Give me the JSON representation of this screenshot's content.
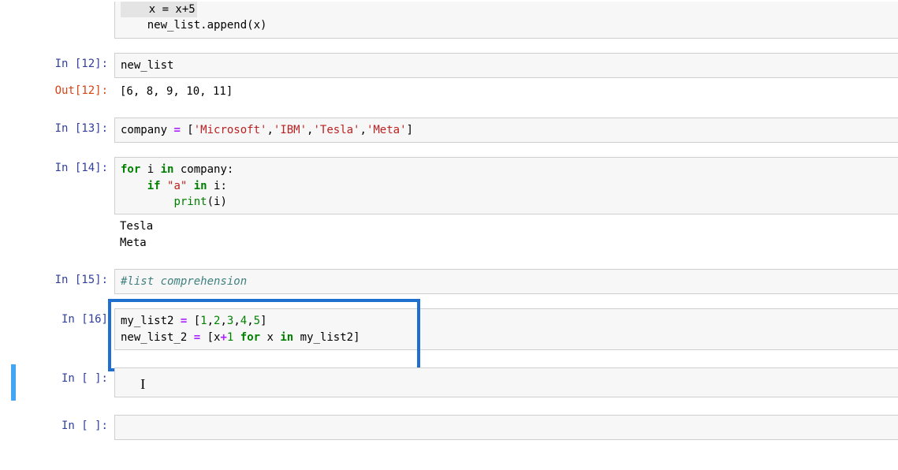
{
  "cells": {
    "partial_top": {
      "line1": "    x = x+5",
      "line2_a": "    new_list.append(x)"
    },
    "c12": {
      "prompt_in": "In [12]:",
      "prompt_out": "Out[12]:",
      "code": "new_list",
      "output": "[6, 8, 9, 10, 11]"
    },
    "c13": {
      "prompt_in": "In [13]:",
      "code_lead": "company ",
      "eq": "=",
      "sp": " [",
      "s1": "'Microsoft'",
      "c1": ",",
      "s2": "'IBM'",
      "c2": ",",
      "s3": "'Tesla'",
      "c3": ",",
      "s4": "'Meta'",
      "end": "]"
    },
    "c14": {
      "prompt_in": "In [14]:",
      "l1_for": "for",
      "l1_mid": " i ",
      "l1_in": "in",
      "l1_end": " company:",
      "l2_pad": "    ",
      "l2_if": "if",
      "l2_sp": " ",
      "l2_str": "\"a\"",
      "l2_sp2": " ",
      "l2_in": "in",
      "l2_end": " i:",
      "l3_pad": "        ",
      "l3_print": "print",
      "l3_paren": "(i)",
      "out_line1": "Tesla",
      "out_line2": "Meta"
    },
    "c15": {
      "prompt_in": "In [15]:",
      "comment": "#list comprehension"
    },
    "c16": {
      "prompt_in": "In [16]",
      "l1_a": "my_list2 ",
      "l1_eq": "=",
      "l1_b": " [",
      "n1": "1",
      "cm1": ",",
      "n2": "2",
      "cm2": ",",
      "n3": "3",
      "cm3": ",",
      "n4": "4",
      "cm4": ",",
      "n5": "5",
      "l1_c": "]",
      "l2_a": "new_list_2 ",
      "l2_eq": "=",
      "l2_b": " [x",
      "l2_plus": "+",
      "l2_one": "1",
      "l2_sp": " ",
      "l2_for": "for",
      "l2_mid": " x ",
      "l2_in": "in",
      "l2_end": " my_list2]"
    },
    "empty": {
      "prompt_in": "In [ ]:"
    }
  },
  "glyphs": {
    "text_cursor": "I"
  },
  "colors": {
    "keyword": "#008000",
    "string": "#BA2121",
    "operator": "#AA22FF",
    "comment": "#408080",
    "prompt_in": "#303F9F",
    "prompt_out": "#D84315",
    "selection_bar": "#42A5F5",
    "annotation_box": "#1f6fd1"
  }
}
